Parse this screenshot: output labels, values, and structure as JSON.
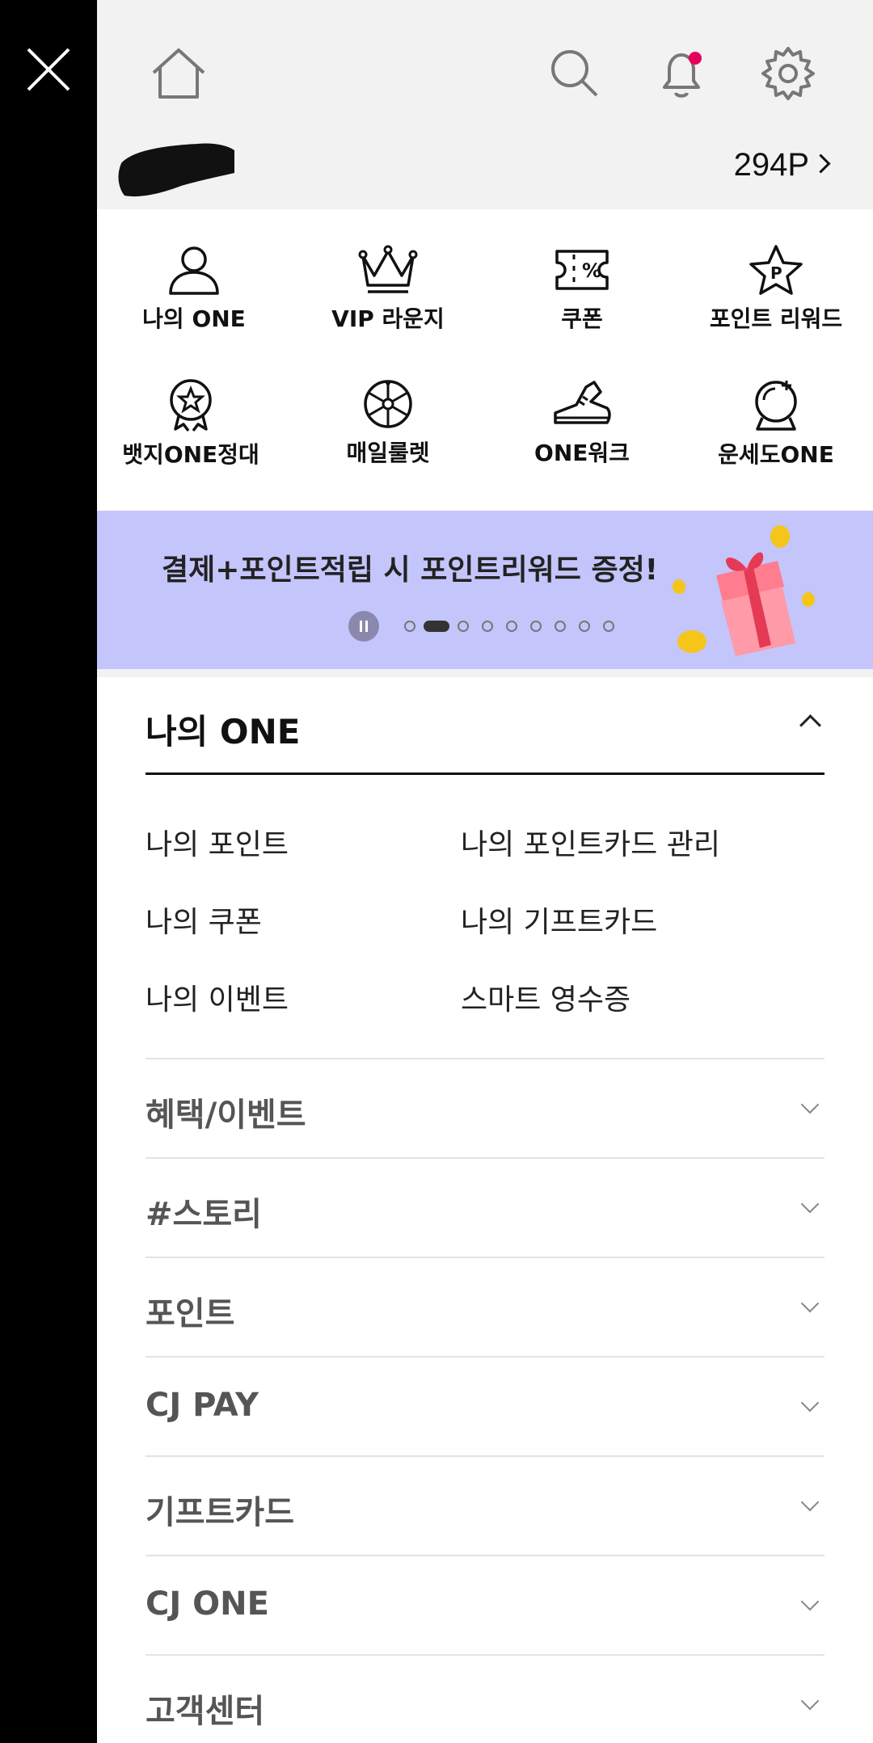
{
  "header": {
    "points": "294P"
  },
  "icons": {
    "close": "close-icon",
    "home": "home-icon",
    "search": "search-icon",
    "notifications": "bell-icon",
    "settings": "gear-icon"
  },
  "colors": {
    "notification_dot": "#e5005a",
    "banner_bg": "#c4c5fb"
  },
  "quick_menu": [
    {
      "label": "나의 ONE",
      "icon": "person-icon"
    },
    {
      "label": "VIP 라운지",
      "icon": "crown-icon"
    },
    {
      "label": "쿠폰",
      "icon": "coupon-icon"
    },
    {
      "label": "포인트 리워드",
      "icon": "star-p-icon"
    },
    {
      "label": "뱃지ONE정대",
      "icon": "badge-icon"
    },
    {
      "label": "매일룰렛",
      "icon": "roulette-icon"
    },
    {
      "label": "ONE워크",
      "icon": "sneaker-icon"
    },
    {
      "label": "운세도ONE",
      "icon": "crystal-ball-icon"
    }
  ],
  "banner": {
    "text": "결제+포인트적립 시 포인트리워드 증정!",
    "slides_total": 9,
    "active_slide": 2
  },
  "my_one": {
    "title": "나의 ONE",
    "items": [
      "나의 포인트",
      "나의 포인트카드 관리",
      "나의 쿠폰",
      "나의 기프트카드",
      "나의 이벤트",
      "스마트 영수증"
    ]
  },
  "accordion": [
    "혜택/이벤트",
    "#스토리",
    "포인트",
    "CJ PAY",
    "기프트카드",
    "CJ ONE",
    "고객센터"
  ]
}
